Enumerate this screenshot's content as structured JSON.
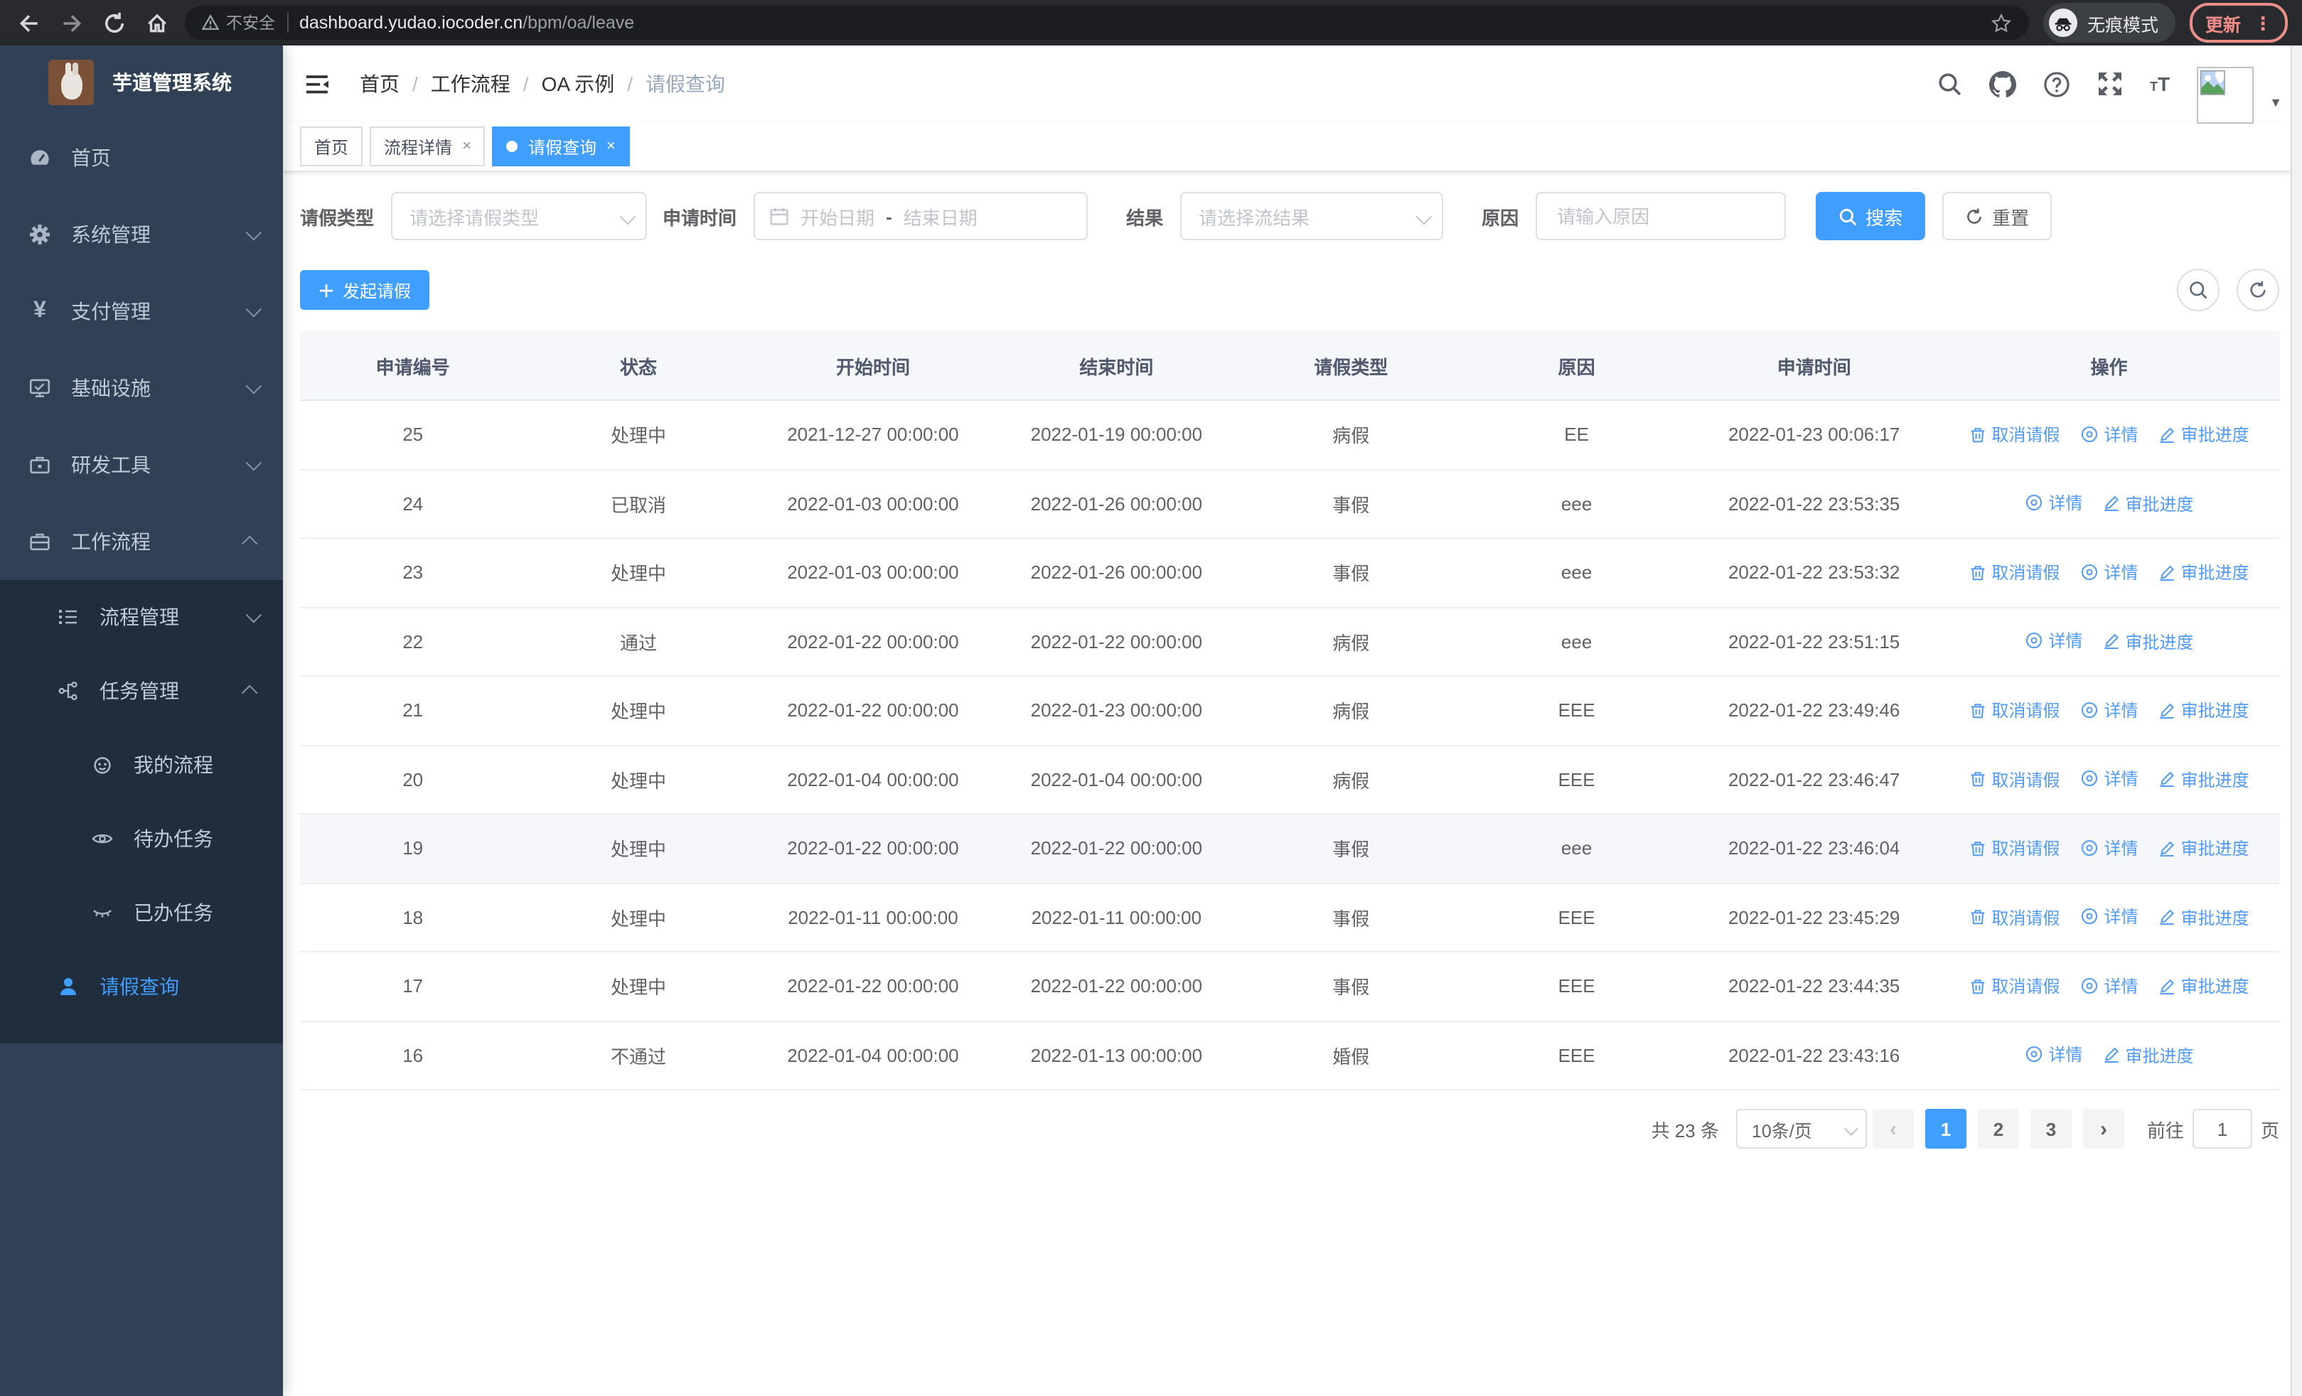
{
  "colors": {
    "accent": "#409eff",
    "sidebar_bg": "#304156",
    "submenu_bg": "#1f2d3d",
    "chrome_bg": "#282a2d",
    "update_accent": "#f08b86",
    "link_blue": "#4f9bf6"
  },
  "browser": {
    "security_label": "不安全",
    "url_host": "dashboard.yudao.iocoder.cn",
    "url_path": "/bpm/oa/leave",
    "incognito_label": "无痕模式",
    "update_label": "更新",
    "menu_dots": "⋮"
  },
  "sidebar": {
    "logo_title": "芋道管理系统",
    "items": [
      {
        "label": "首页"
      },
      {
        "label": "系统管理"
      },
      {
        "label": "支付管理"
      },
      {
        "label": "基础设施"
      },
      {
        "label": "研发工具"
      },
      {
        "label": "工作流程"
      },
      {
        "label": "流程管理"
      },
      {
        "label": "任务管理"
      },
      {
        "label": "我的流程"
      },
      {
        "label": "待办任务"
      },
      {
        "label": "已办任务"
      },
      {
        "label": "请假查询"
      }
    ]
  },
  "breadcrumb": {
    "separator": "/",
    "items": [
      "首页",
      "工作流程",
      "OA 示例",
      "请假查询"
    ]
  },
  "tabs": [
    {
      "label": "首页"
    },
    {
      "label": "流程详情",
      "close": "×"
    },
    {
      "label": "请假查询",
      "close": "×",
      "active": true
    }
  ],
  "filters": {
    "leave_type_label": "请假类型",
    "leave_type_placeholder": "请选择请假类型",
    "apply_time_label": "申请时间",
    "start_date_placeholder": "开始日期",
    "range_separator": "-",
    "end_date_placeholder": "结束日期",
    "result_label": "结果",
    "result_placeholder": "请选择流结果",
    "reason_label": "原因",
    "reason_placeholder": "请输入原因",
    "search_label": "搜索",
    "reset_label": "重置"
  },
  "toolbar": {
    "create_label": "发起请假"
  },
  "table": {
    "columns": [
      "申请编号",
      "状态",
      "开始时间",
      "结束时间",
      "请假类型",
      "原因",
      "申请时间",
      "操作"
    ],
    "action_labels": {
      "cancel": "取消请假",
      "detail": "详情",
      "progress": "审批进度"
    },
    "rows": [
      {
        "id": "25",
        "status": "处理中",
        "start": "2021-12-27 00:00:00",
        "end": "2022-01-19 00:00:00",
        "type": "病假",
        "reason": "EE",
        "applied": "2022-01-23 00:06:17",
        "cancellable": true
      },
      {
        "id": "24",
        "status": "已取消",
        "start": "2022-01-03 00:00:00",
        "end": "2022-01-26 00:00:00",
        "type": "事假",
        "reason": "eee",
        "applied": "2022-01-22 23:53:35",
        "cancellable": false
      },
      {
        "id": "23",
        "status": "处理中",
        "start": "2022-01-03 00:00:00",
        "end": "2022-01-26 00:00:00",
        "type": "事假",
        "reason": "eee",
        "applied": "2022-01-22 23:53:32",
        "cancellable": true
      },
      {
        "id": "22",
        "status": "通过",
        "start": "2022-01-22 00:00:00",
        "end": "2022-01-22 00:00:00",
        "type": "病假",
        "reason": "eee",
        "applied": "2022-01-22 23:51:15",
        "cancellable": false
      },
      {
        "id": "21",
        "status": "处理中",
        "start": "2022-01-22 00:00:00",
        "end": "2022-01-23 00:00:00",
        "type": "病假",
        "reason": "EEE",
        "applied": "2022-01-22 23:49:46",
        "cancellable": true
      },
      {
        "id": "20",
        "status": "处理中",
        "start": "2022-01-04 00:00:00",
        "end": "2022-01-04 00:00:00",
        "type": "病假",
        "reason": "EEE",
        "applied": "2022-01-22 23:46:47",
        "cancellable": true
      },
      {
        "id": "19",
        "status": "处理中",
        "start": "2022-01-22 00:00:00",
        "end": "2022-01-22 00:00:00",
        "type": "事假",
        "reason": "eee",
        "applied": "2022-01-22 23:46:04",
        "cancellable": true,
        "hover": true
      },
      {
        "id": "18",
        "status": "处理中",
        "start": "2022-01-11 00:00:00",
        "end": "2022-01-11 00:00:00",
        "type": "事假",
        "reason": "EEE",
        "applied": "2022-01-22 23:45:29",
        "cancellable": true
      },
      {
        "id": "17",
        "status": "处理中",
        "start": "2022-01-22 00:00:00",
        "end": "2022-01-22 00:00:00",
        "type": "事假",
        "reason": "EEE",
        "applied": "2022-01-22 23:44:35",
        "cancellable": true
      },
      {
        "id": "16",
        "status": "不通过",
        "start": "2022-01-04 00:00:00",
        "end": "2022-01-13 00:00:00",
        "type": "婚假",
        "reason": "EEE",
        "applied": "2022-01-22 23:43:16",
        "cancellable": false
      }
    ]
  },
  "pagination": {
    "total_label": "共 23 条",
    "page_size_label": "10条/页",
    "prev_label": "‹",
    "next_label": "›",
    "pages": [
      "1",
      "2",
      "3"
    ],
    "active_page": "1",
    "goto_label": "前往",
    "goto_value": "1",
    "page_unit_label": "页"
  }
}
